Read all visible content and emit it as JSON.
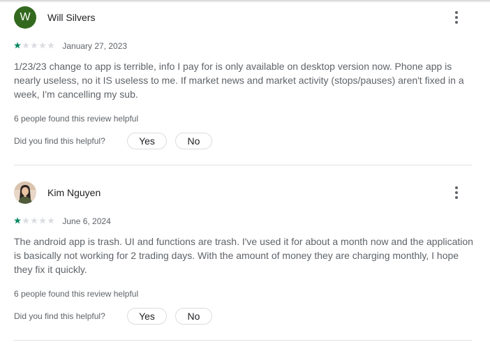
{
  "reviews": [
    {
      "author": "Will Silvers",
      "avatar_letter": "W",
      "avatar_color": "#33691e",
      "rating": 1,
      "rating_max": 5,
      "date": "January 27, 2023",
      "text": "1/23/23 change to app is terrible, info I pay for is only available on desktop version now. Phone app is nearly useless, no it IS useless to me. If market news and market activity (stops/pauses) aren't fixed in a week, I'm cancelling my sub.",
      "helpful_count_text": "6 people found this review helpful",
      "helpful_question": "Did you find this helpful?",
      "yes_label": "Yes",
      "no_label": "No",
      "menu_icon": "more-vert-icon"
    },
    {
      "author": "Kim Nguyen",
      "avatar_icon": "avatar-photo",
      "rating": 1,
      "rating_max": 5,
      "date": "June 6, 2024",
      "text": "The android app is trash. UI and functions are trash. I've used it for about a month now and the application is basically not working for 2 trading days. With the amount of money they are charging monthly, I hope they fix it quickly.",
      "helpful_count_text": "6 people found this review helpful",
      "helpful_question": "Did you find this helpful?",
      "yes_label": "Yes",
      "no_label": "No",
      "menu_icon": "more-vert-icon"
    }
  ],
  "colors": {
    "star_filled": "#01875f",
    "star_empty": "#dadce0",
    "text_primary": "#202124",
    "text_secondary": "#5f6368"
  }
}
